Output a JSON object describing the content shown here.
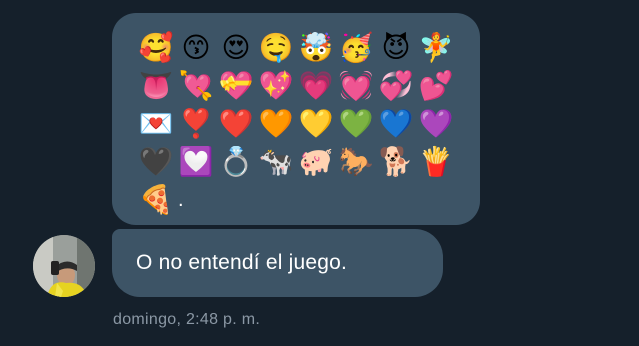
{
  "conversation": {
    "emoji_message": {
      "rows": [
        [
          "🥰",
          "😙",
          "😍",
          "🤤",
          "🤯",
          "🥳",
          "😈",
          "🧚"
        ],
        [
          "👅",
          "💘",
          "💝",
          "💖",
          "💗",
          "💓",
          "💞",
          "💕"
        ],
        [
          "💌",
          "❣️",
          "❤️",
          "🧡",
          "💛",
          "💚",
          "💙",
          "💜"
        ],
        [
          "🖤",
          "💟",
          "💍",
          "🐄",
          "🐖",
          "🐎",
          "🐕",
          "🍟"
        ],
        [
          "🍕"
        ]
      ],
      "trailing_text": "."
    },
    "text_message": {
      "text": "O no entendí el juego."
    },
    "timestamp": "domingo, 2:48 p. m."
  },
  "sender": {
    "avatar_icon": "user-avatar-photo"
  },
  "colors": {
    "background": "#15202b",
    "bubble": "#3d5466",
    "timestamp": "#8b98a5"
  }
}
